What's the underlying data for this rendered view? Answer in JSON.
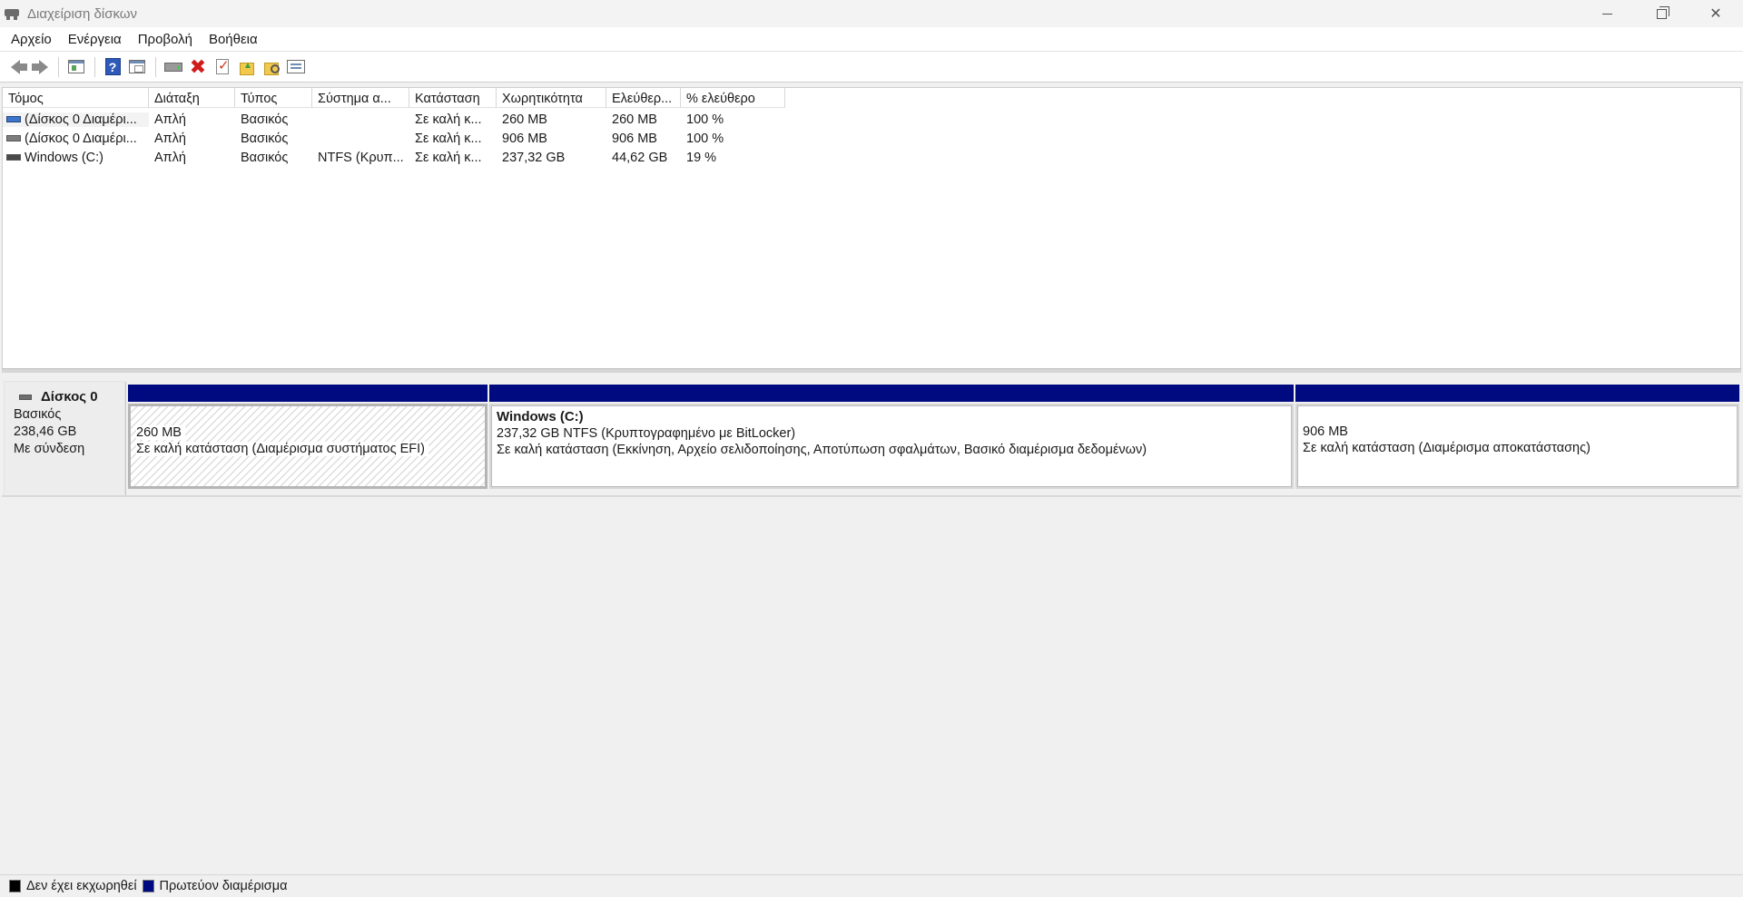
{
  "window": {
    "title": "Διαχείριση δίσκων"
  },
  "menu": [
    {
      "label": "Αρχείο"
    },
    {
      "label": "Ενέργεια"
    },
    {
      "label": "Προβολή"
    },
    {
      "label": "Βοήθεια"
    }
  ],
  "toolbar": {
    "icons": [
      "back-arrow-icon",
      "forward-arrow-icon",
      "show-hide-console-tree-icon",
      "help-icon",
      "properties-icon",
      "connect-drive-icon",
      "delete-icon",
      "check-icon",
      "folder-up-icon",
      "folder-search-icon",
      "list-view-icon"
    ]
  },
  "volume_list": {
    "columns": [
      "Τόμος",
      "Διάταξη",
      "Τύπος",
      "Σύστημα α...",
      "Κατάσταση",
      "Χωρητικότητα",
      "Ελεύθερ...",
      "% ελεύθερο"
    ],
    "rows": [
      {
        "volume": "(Δίσκος 0 Διαμέρι...",
        "layout": "Απλή",
        "type": "Βασικός",
        "fs": "",
        "status": "Σε καλή κ...",
        "capacity": "260 MB",
        "free": "260 MB",
        "pct_free": "100 %",
        "icon": "blue"
      },
      {
        "volume": "(Δίσκος 0 Διαμέρι...",
        "layout": "Απλή",
        "type": "Βασικός",
        "fs": "",
        "status": "Σε καλή κ...",
        "capacity": "906 MB",
        "free": "906 MB",
        "pct_free": "100 %",
        "icon": "gray"
      },
      {
        "volume": "Windows (C:)",
        "layout": "Απλή",
        "type": "Βασικός",
        "fs": "NTFS (Κρυπ...",
        "status": "Σε καλή κ...",
        "capacity": "237,32 GB",
        "free": "44,62 GB",
        "pct_free": "19 %",
        "icon": "dark"
      }
    ]
  },
  "disk": {
    "name": "Δίσκος 0",
    "type": "Βασικός",
    "size": "238,46 GB",
    "state": "Με σύνδεση",
    "partitions": [
      {
        "name": "",
        "size_line": "260 MB",
        "status_line": "Σε καλή κατάσταση (Διαμέρισμα συστήματος EFI)"
      },
      {
        "name": "Windows  (C:)",
        "size_line": "237,32 GB NTFS (Κρυπτογραφημένο με BitLocker)",
        "status_line": "Σε καλή κατάσταση (Εκκίνηση, Αρχείο σελιδοποίησης, Αποτύπωση σφαλμάτων, Βασικό διαμέρισμα δεδομένων)"
      },
      {
        "name": "",
        "size_line": "906 MB",
        "status_line": "Σε καλή κατάσταση (Διαμέρισμα αποκατάστασης)"
      }
    ]
  },
  "legend": [
    {
      "label": "Δεν έχει εκχωρηθεί",
      "color": "#000000"
    },
    {
      "label": "Πρωτεύον διαμέρισμα",
      "color": "#000a80"
    }
  ],
  "colors": {
    "primary_partition": "#000a80",
    "unallocated": "#000000"
  }
}
